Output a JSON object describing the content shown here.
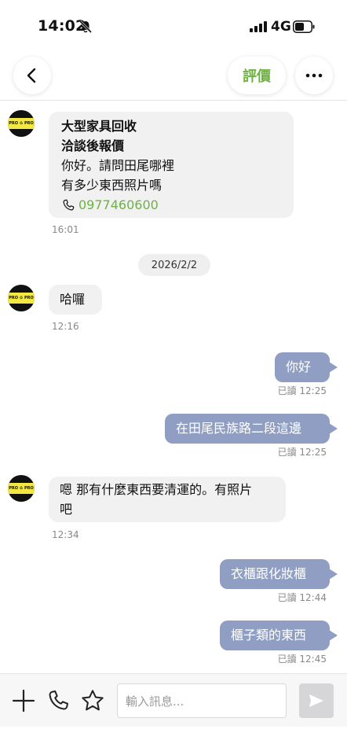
{
  "status_bar": {
    "time": "14:02",
    "network": "4G"
  },
  "header": {
    "rate_label": "評價"
  },
  "messages": {
    "m1": {
      "line1": "大型家具回收",
      "line2": "洽談後報價",
      "line3": "你好。請問田尾哪裡",
      "line4": "有多少東西照片嗎",
      "phone": "0977460600",
      "time": "16:01"
    },
    "date_divider": "2026/2/2",
    "m2": {
      "text": "哈囉",
      "time": "12:16"
    },
    "m3": {
      "text": "你好",
      "read": "已讀",
      "time": "12:25"
    },
    "m4": {
      "text": "在田尾民族路二段這邊",
      "read": "已讀",
      "time": "12:25"
    },
    "m5": {
      "line1": "嗯 那有什麼東西要清運的。有照片",
      "line2": "吧",
      "time": "12:34"
    },
    "m6": {
      "text": "衣櫃跟化妝櫃",
      "read": "已讀",
      "time": "12:44"
    },
    "m7": {
      "text": "櫃子類的東西",
      "read": "已讀",
      "time": "12:45"
    }
  },
  "composer": {
    "placeholder": "輸入訊息..."
  },
  "avatar_logo": "PRO ♻ PRO",
  "colors": {
    "accent_green": "#6db33f",
    "outgoing_bubble": "#8f9ec2",
    "incoming_bubble": "#f1f1f2"
  }
}
